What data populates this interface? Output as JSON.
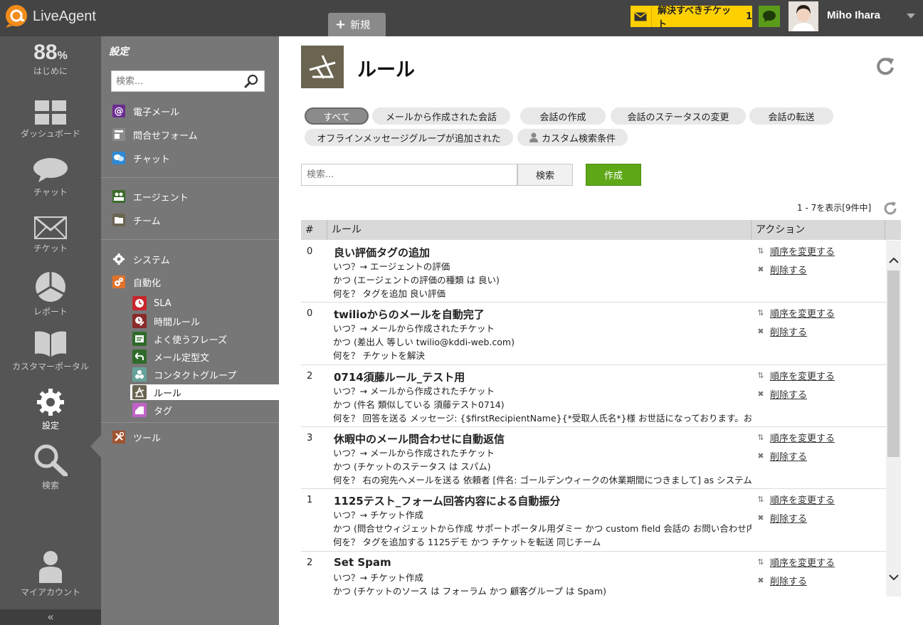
{
  "app": {
    "name": "LiveAgent",
    "new_tab_label": "新規",
    "ticket_alert_label": "解決すべきチケット",
    "ticket_alert_count": "1",
    "user_name": "Miho Ihara"
  },
  "leftnav": {
    "progress_value": "88",
    "progress_unit": "%",
    "items": [
      {
        "label": "はじめに"
      },
      {
        "label": "ダッシュボード"
      },
      {
        "label": "チャット"
      },
      {
        "label": "チケット"
      },
      {
        "label": "レポート"
      },
      {
        "label": "カスタマーポータル"
      },
      {
        "label": "設定"
      },
      {
        "label": "検索"
      },
      {
        "label": "マイアカウント"
      }
    ],
    "collapse_glyph": "«"
  },
  "settings": {
    "title": "設定",
    "search_placeholder": "検索...",
    "items": [
      {
        "label": "電子メール",
        "color": "#6b2c91"
      },
      {
        "label": "問合せフォーム",
        "color": "#8a8a8a"
      },
      {
        "label": "チャット",
        "color": "#2f8ad6"
      },
      {
        "label": "エージェント",
        "color": "#3b6b2a"
      },
      {
        "label": "チーム",
        "color": "#6b6451"
      },
      {
        "label": "システム",
        "color": "#777777"
      },
      {
        "label": "自動化",
        "color": "#e0732a"
      }
    ],
    "sub_items": [
      {
        "label": "SLA",
        "color": "#c8262c"
      },
      {
        "label": "時間ルール",
        "color": "#8b2a2a"
      },
      {
        "label": "よく使うフレーズ",
        "color": "#2f6b2a"
      },
      {
        "label": "メール定型文",
        "color": "#2f6b2a"
      },
      {
        "label": "コンタクトグループ",
        "color": "#67a39a"
      },
      {
        "label": "ルール",
        "color": "#6b6451"
      },
      {
        "label": "タグ",
        "color": "#c062c9"
      }
    ],
    "tools_label": "ツール",
    "tools_color": "#a0522d"
  },
  "main": {
    "title": "ルール",
    "filters": [
      {
        "label": "すべて"
      },
      {
        "label": "メールから作成された会話"
      },
      {
        "label": "会話の作成"
      },
      {
        "label": "会話のステータスの変更"
      },
      {
        "label": "会話の転送"
      },
      {
        "label": "オフラインメッセージグループが追加された"
      },
      {
        "label": "カスタム検索条件"
      }
    ],
    "search_placeholder": "検索...",
    "search_button": "検索",
    "create_button": "作成",
    "paging": "1 - 7を表示[9件中]",
    "columns": {
      "num": "#",
      "rule": "ルール",
      "action": "アクション"
    },
    "action_reorder": "順序を変更する",
    "action_delete": "削除する",
    "rows": [
      {
        "num": "0",
        "title": "良い評価タグの追加",
        "lines": [
          "いつ？→ エージェントの評価",
          "かつ (エージェントの評価の種類 は 良い)",
          "何を？ タグを追加 良い評価"
        ]
      },
      {
        "num": "0",
        "title": "twilioからのメールを自動完了",
        "lines": [
          "いつ？→ メールから作成されたチケット",
          "かつ (差出人 等しい twilio@kddi-web.com)",
          "何を？ チケットを解決"
        ]
      },
      {
        "num": "2",
        "title": "0714須藤ルール_テスト用",
        "lines": [
          "いつ？→ メールから作成されたチケット",
          "かつ (件名 類似している 須藤テスト0714)",
          "何を？ 回答を送る メッセージ: {$firstRecipientName}{*受取人氏名*}様 お世話になっております。お問"
        ]
      },
      {
        "num": "3",
        "title": "休暇中のメール問合わせに自動返信",
        "lines": [
          "いつ？→ メールから作成されたチケット",
          "かつ (チケットのステータス は スパム)",
          "何を？ 右の宛先へメールを送る 依頼者 [件名: ゴールデンウィークの休業期間につきまして] as システム"
        ]
      },
      {
        "num": "1",
        "title": "1125テスト_フォーム回答内容による自動振分",
        "lines": [
          "いつ？→ チケット作成",
          "かつ (問合せウィジェットから作成 サポートポータル用ダミー かつ custom field 会話の お問い合わせ内",
          "何を？ タグを追加する 1125デモ かつ チケットを転送 同じチーム"
        ]
      },
      {
        "num": "2",
        "title": "Set Spam",
        "lines": [
          "いつ？→ チケット作成",
          "かつ (チケットのソース は フォーラム かつ 顧客グループ は Spam)"
        ]
      }
    ]
  }
}
